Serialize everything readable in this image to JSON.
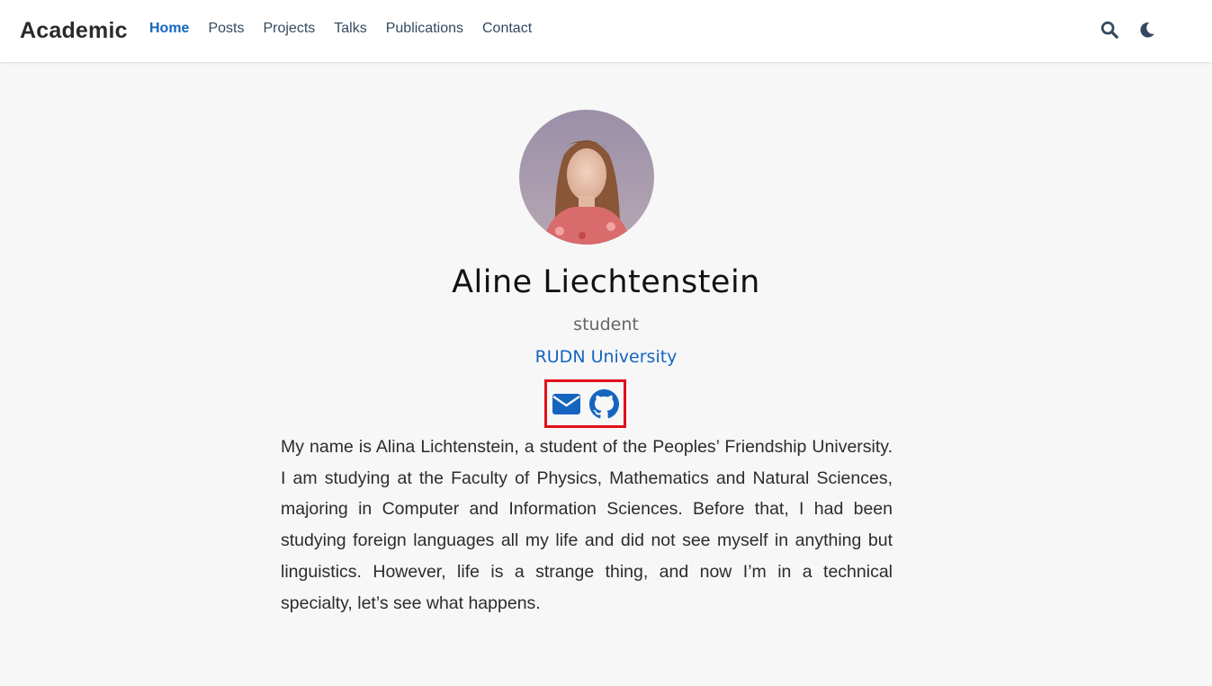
{
  "navbar": {
    "brand": "Academic",
    "links": [
      {
        "label": "Home",
        "active": true
      },
      {
        "label": "Posts"
      },
      {
        "label": "Projects"
      },
      {
        "label": "Talks"
      },
      {
        "label": "Publications"
      },
      {
        "label": "Contact"
      }
    ],
    "icons": [
      "search-icon",
      "moon-icon"
    ]
  },
  "profile": {
    "name": "Aline Liechtenstein",
    "role": "student",
    "organization": "RUDN University",
    "social_icons": [
      "envelope-icon",
      "github-icon"
    ],
    "bio": "My name is Alina Lichtenstein, a student of the Peoples’ Friendship University. I am studying at the Faculty of Physics, Mathematics and Natural Sciences, majoring in Computer and Information Sciences. Before that, I had been studying foreign languages all my life and did not see myself in anything but linguistics. However, life is a strange thing, and now I’m in a technical specialty, let’s see what happens."
  },
  "colors": {
    "accent": "#1565c0",
    "highlight_border": "#e0101a",
    "background": "#f7f7f7"
  }
}
